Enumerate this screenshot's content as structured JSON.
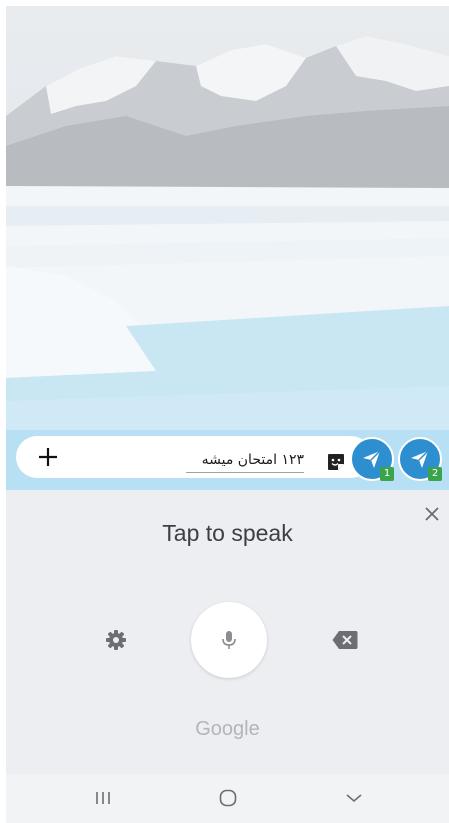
{
  "composer": {
    "message_text": "۱۲۳ امتحان میشه",
    "send_button_1_badge": "1",
    "send_button_2_badge": "2"
  },
  "voice_input": {
    "title": "Tap to speak",
    "brand": "Google"
  },
  "colors": {
    "composer_bg": "#b8e0f4",
    "send_button": "#2e8fd0",
    "badge": "#3ba44a",
    "panel_bg": "#eceef1"
  },
  "icons": {
    "attach": "plus-icon",
    "sticker": "sticker-icon",
    "send": "send-icon",
    "close": "close-icon",
    "settings": "gear-icon",
    "microphone": "microphone-icon",
    "backspace": "backspace-icon",
    "nav_recents": "recents-icon",
    "nav_home": "home-icon",
    "nav_back": "back-icon"
  }
}
